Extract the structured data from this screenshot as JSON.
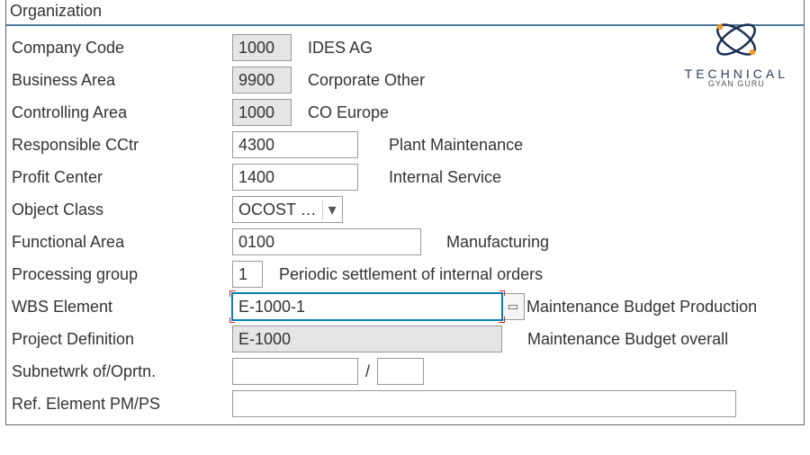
{
  "sectionTitle": "Organization",
  "rows": {
    "companyCode": {
      "label": "Company Code",
      "value": "1000",
      "desc": "IDES AG"
    },
    "businessArea": {
      "label": "Business Area",
      "value": "9900",
      "desc": "Corporate Other"
    },
    "controllingArea": {
      "label": "Controlling Area",
      "value": "1000",
      "desc": "CO Europe"
    },
    "responsibleCCtr": {
      "label": "Responsible CCtr",
      "value": "4300",
      "desc": "Plant Maintenance"
    },
    "profitCenter": {
      "label": "Profit Center",
      "value": "1400",
      "desc": "Internal Service"
    },
    "objectClass": {
      "label": "Object Class",
      "value": "OCOST …"
    },
    "functionalArea": {
      "label": "Functional Area",
      "value": "0100",
      "desc": "Manufacturing"
    },
    "processingGroup": {
      "label": "Processing group",
      "value": "1",
      "desc": "Periodic settlement of internal orders"
    },
    "wbsElement": {
      "label": "WBS Element",
      "value": "E-1000-1",
      "desc": "Maintenance Budget Production"
    },
    "projectDefinition": {
      "label": "Project Definition",
      "value": "E-1000",
      "desc": "Maintenance Budget overall"
    },
    "subnetwork": {
      "label": "Subnetwrk of/Oprtn.",
      "value1": "",
      "value2": ""
    },
    "refElement": {
      "label": "Ref. Element PM/PS",
      "value": ""
    }
  },
  "logo": {
    "line1": "TECHNICAL",
    "line2": "GYAN GURU"
  },
  "separator": "/"
}
